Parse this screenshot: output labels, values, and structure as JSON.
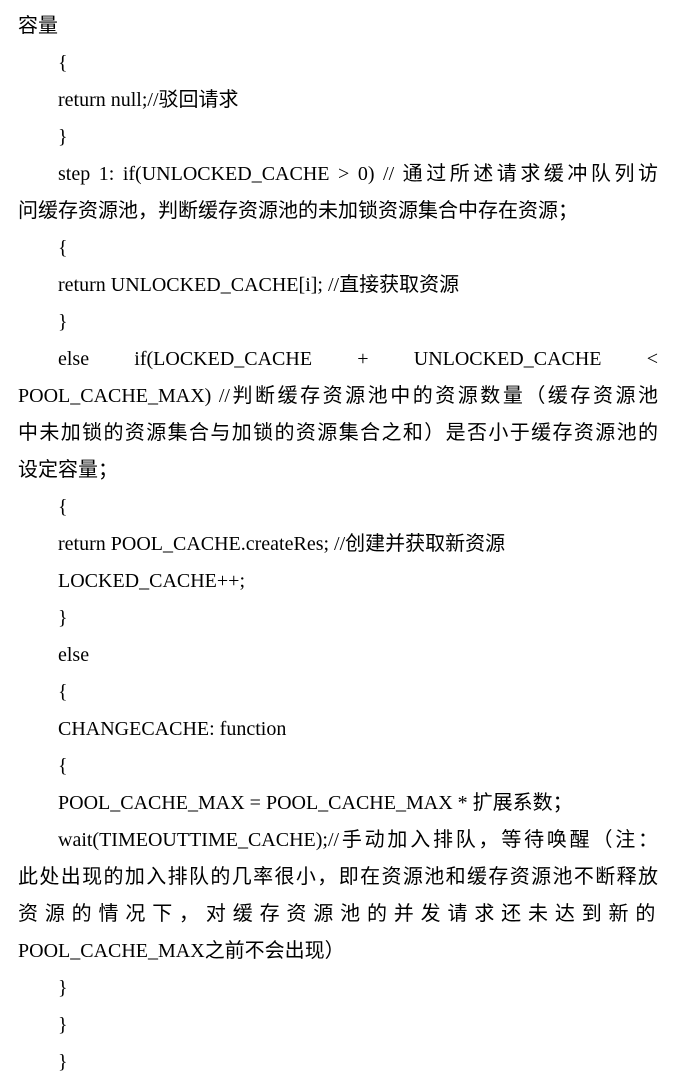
{
  "lines": {
    "l1": "容量",
    "l2": "{",
    "l3a": "return null;//",
    "l3b": "驳回请求",
    "l4": "}",
    "l5a": "step 1: if(UNLOCKED_CACHE > 0) // ",
    "l5b": "通过所述请求缓冲队列访",
    "l6": "问缓存资源池，判断缓存资源池的未加锁资源集合中存在资源；",
    "l7": "{",
    "l8a": "return UNLOCKED_CACHE[i]; //",
    "l8b": "直接获取资源",
    "l9": "}",
    "l10": "else",
    "l10b": "if(LOCKED_CACHE",
    "l10c": "+",
    "l10d": "UNLOCKED_CACHE",
    "l10e": "<",
    "l11a": "POOL_CACHE_MAX) //",
    "l11b": "判断缓存资源池中的资源数量（缓存资源池",
    "l12": "中未加锁的资源集合与加锁的资源集合之和）是否小于缓存资源池的",
    "l13": "设定容量；",
    "l14": "{",
    "l15a": "return POOL_CACHE.createRes; //",
    "l15b": "创建并获取新资源",
    "l16": "LOCKED_CACHE++;",
    "l17": "}",
    "l18": "else",
    "l19": "{",
    "l20": "CHANGECACHE: function",
    "l21": "{",
    "l22a": "POOL_CACHE_MAX = POOL_CACHE_MAX * ",
    "l22b": "扩展系数；",
    "l23a": "wait(TIMEOUTTIME_CACHE);//",
    "l23b": "手动加入排队，等待唤醒（注：",
    "l24": "此处出现的加入排队的几率很小，即在资源池和缓存资源池不断释放",
    "l25a": "资源的情况下，对缓存资源池的并发请求还未达到新的",
    "l25b": "POOL_CACHE_MAX",
    "l25c": "之前不会出现）",
    "l26": "}",
    "l27": "}",
    "l28": "}"
  }
}
